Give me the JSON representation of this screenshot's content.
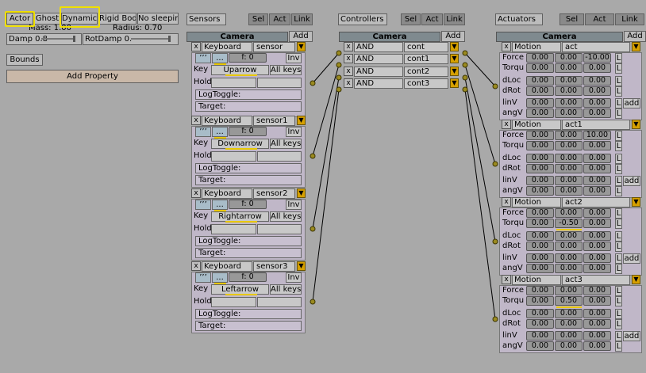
{
  "actor": {
    "actor": "Actor",
    "ghost": "Ghost",
    "dynamic": "Dynamic",
    "rigid": "Rigid Bod",
    "nosleep": "No sleepin",
    "mass": "Mass: 1.00",
    "radius": "Radius: 0.70",
    "damp": "Damp 0.8",
    "rotdamp": "RotDamp 0.",
    "bounds": "Bounds",
    "add_property": "Add Property"
  },
  "headers": {
    "sensors": "Sensors",
    "controllers": "Controllers",
    "actuators": "Actuators",
    "sel": "Sel",
    "act": "Act",
    "link": "Link",
    "camera": "Camera",
    "add": "Add"
  },
  "sensors": [
    {
      "type": "Keyboard",
      "name": "sensor",
      "freq": "f: 0",
      "inv": "Inv",
      "key_label": "Key",
      "key": "Uparrow",
      "all": "All keys",
      "hold": "Hold",
      "logtoggle": "LogToggle:",
      "target": "Target:"
    },
    {
      "type": "Keyboard",
      "name": "sensor1",
      "freq": "f: 0",
      "inv": "Inv",
      "key_label": "Key",
      "key": "Downarrow",
      "all": "All keys",
      "hold": "Hold",
      "logtoggle": "LogToggle:",
      "target": "Target:"
    },
    {
      "type": "Keyboard",
      "name": "sensor2",
      "freq": "f: 0",
      "inv": "Inv",
      "key_label": "Key",
      "key": "Rightarrow",
      "all": "All keys",
      "hold": "Hold",
      "logtoggle": "LogToggle:",
      "target": "Target:"
    },
    {
      "type": "Keyboard",
      "name": "sensor3",
      "freq": "f: 0",
      "inv": "Inv",
      "key_label": "Key",
      "key": "Leftarrow",
      "all": "All keys",
      "hold": "Hold",
      "logtoggle": "LogToggle:",
      "target": "Target:"
    }
  ],
  "controllers": [
    {
      "type": "AND",
      "name": "cont"
    },
    {
      "type": "AND",
      "name": "cont1"
    },
    {
      "type": "AND",
      "name": "cont2"
    },
    {
      "type": "AND",
      "name": "cont3"
    }
  ],
  "actuators": [
    {
      "type": "Motion",
      "name": "act",
      "rows": [
        {
          "label": "Force",
          "v": [
            "0.00",
            "0.00",
            "-10.00"
          ]
        },
        {
          "label": "Torqu",
          "v": [
            "0.00",
            "0.00",
            "0.00"
          ]
        },
        {
          "label": "dLoc",
          "v": [
            "0.00",
            "0.00",
            "0.00"
          ]
        },
        {
          "label": "dRot",
          "v": [
            "0.00",
            "0.00",
            "0.00"
          ]
        },
        {
          "label": "linV",
          "v": [
            "0.00",
            "0.00",
            "0.00"
          ]
        },
        {
          "label": "angV",
          "v": [
            "0.00",
            "0.00",
            "0.00"
          ]
        }
      ],
      "L": "L",
      "add": "add"
    },
    {
      "type": "Motion",
      "name": "act1",
      "rows": [
        {
          "label": "Force",
          "v": [
            "0.00",
            "0.00",
            "10.00"
          ]
        },
        {
          "label": "Torqu",
          "v": [
            "0.00",
            "0.00",
            "0.00"
          ]
        },
        {
          "label": "dLoc",
          "v": [
            "0.00",
            "0.00",
            "0.00"
          ]
        },
        {
          "label": "dRot",
          "v": [
            "0.00",
            "0.00",
            "0.00"
          ]
        },
        {
          "label": "linV",
          "v": [
            "0.00",
            "0.00",
            "0.00"
          ]
        },
        {
          "label": "angV",
          "v": [
            "0.00",
            "0.00",
            "0.00"
          ]
        }
      ],
      "L": "L",
      "add": "add"
    },
    {
      "type": "Motion",
      "name": "act2",
      "rows": [
        {
          "label": "Force",
          "v": [
            "0.00",
            "0.00",
            "0.00"
          ]
        },
        {
          "label": "Torqu",
          "v": [
            "0.00",
            "-0.50",
            "0.00"
          ]
        },
        {
          "label": "dLoc",
          "v": [
            "0.00",
            "0.00",
            "0.00"
          ]
        },
        {
          "label": "dRot",
          "v": [
            "0.00",
            "0.00",
            "0.00"
          ]
        },
        {
          "label": "linV",
          "v": [
            "0.00",
            "0.00",
            "0.00"
          ]
        },
        {
          "label": "angV",
          "v": [
            "0.00",
            "0.00",
            "0.00"
          ]
        }
      ],
      "L": "L",
      "add": "add"
    },
    {
      "type": "Motion",
      "name": "act3",
      "rows": [
        {
          "label": "Force",
          "v": [
            "0.00",
            "0.00",
            "0.00"
          ]
        },
        {
          "label": "Torqu",
          "v": [
            "0.00",
            "0.50",
            "0.00"
          ]
        },
        {
          "label": "dLoc",
          "v": [
            "0.00",
            "0.00",
            "0.00"
          ]
        },
        {
          "label": "dRot",
          "v": [
            "0.00",
            "0.00",
            "0.00"
          ]
        },
        {
          "label": "linV",
          "v": [
            "0.00",
            "0.00",
            "0.00"
          ]
        },
        {
          "label": "angV",
          "v": [
            "0.00",
            "0.00",
            "0.00"
          ]
        }
      ],
      "L": "L",
      "add": "add"
    }
  ],
  "colors": {
    "highlight": "#f0e000",
    "accent": "#d6a000",
    "wire": "#000000"
  }
}
